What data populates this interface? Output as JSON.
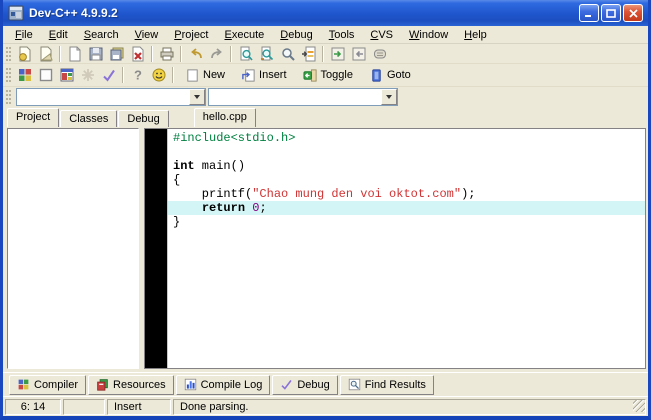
{
  "window": {
    "title": "Dev-C++ 4.9.9.2"
  },
  "colors": {
    "titlebar_blue": "#1f55cc",
    "window_border": "#1847c0",
    "chrome": "#ece9d8",
    "highlight_line": "#d3f5f5",
    "directive_green": "#008040",
    "string_red": "#d03434",
    "number_purple": "#800080",
    "gutter_black": "#000000"
  },
  "menu": {
    "items": [
      "File",
      "Edit",
      "Search",
      "View",
      "Project",
      "Execute",
      "Debug",
      "Tools",
      "CVS",
      "Window",
      "Help"
    ]
  },
  "toolbar_main": {
    "icons": [
      "new-project",
      "open",
      "new-file",
      "save",
      "save-all",
      "close-file",
      "print",
      "undo",
      "redo",
      "find",
      "replace",
      "find-in-files",
      "goto-line",
      "add-to-project",
      "remove-from-project",
      "properties"
    ]
  },
  "toolbar_secondary": {
    "icons": [
      "compile",
      "run",
      "compile-and-run",
      "rebuild-all",
      "debug-check",
      "help",
      "about"
    ],
    "bookmark_buttons": [
      {
        "icon": "new-bookmark",
        "label": "New"
      },
      {
        "icon": "insert-bookmark",
        "label": "Insert"
      },
      {
        "icon": "toggle-bookmark",
        "label": "Toggle"
      },
      {
        "icon": "goto-bookmark",
        "label": "Goto"
      }
    ]
  },
  "combos": {
    "first_value": "",
    "second_value": ""
  },
  "left_panel": {
    "tabs": [
      {
        "label": "Project",
        "active": true
      },
      {
        "label": "Classes",
        "active": false
      },
      {
        "label": "Debug",
        "active": false
      }
    ]
  },
  "editor": {
    "tab": "hello.cpp",
    "highlighted_line_number": 6,
    "lines": [
      {
        "segments": [
          {
            "text": "#include<stdio.h>",
            "style": "directive"
          }
        ]
      },
      {
        "segments": [
          {
            "text": "",
            "style": "plain"
          }
        ]
      },
      {
        "segments": [
          {
            "text": "int",
            "style": "keyword"
          },
          {
            "text": " main()",
            "style": "plain"
          }
        ]
      },
      {
        "segments": [
          {
            "text": "{",
            "style": "plain"
          }
        ]
      },
      {
        "segments": [
          {
            "text": "    printf(",
            "style": "plain"
          },
          {
            "text": "\"Chao mung den voi oktot.com\"",
            "style": "string"
          },
          {
            "text": ");",
            "style": "plain"
          }
        ]
      },
      {
        "segments": [
          {
            "text": "    ",
            "style": "plain"
          },
          {
            "text": "return",
            "style": "keyword"
          },
          {
            "text": " ",
            "style": "plain"
          },
          {
            "text": "0",
            "style": "number"
          },
          {
            "text": ";",
            "style": "plain"
          }
        ]
      },
      {
        "segments": [
          {
            "text": "}",
            "style": "plain"
          }
        ]
      }
    ]
  },
  "bottom_tabs": [
    {
      "icon": "compiler",
      "label": "Compiler"
    },
    {
      "icon": "resources",
      "label": "Resources"
    },
    {
      "icon": "compile-log",
      "label": "Compile Log"
    },
    {
      "icon": "debug",
      "label": "Debug"
    },
    {
      "icon": "find-results",
      "label": "Find Results"
    }
  ],
  "status_bar": {
    "cursor_position": "6: 14",
    "modified_flag": "",
    "mode": "Insert",
    "message": "Done parsing."
  }
}
